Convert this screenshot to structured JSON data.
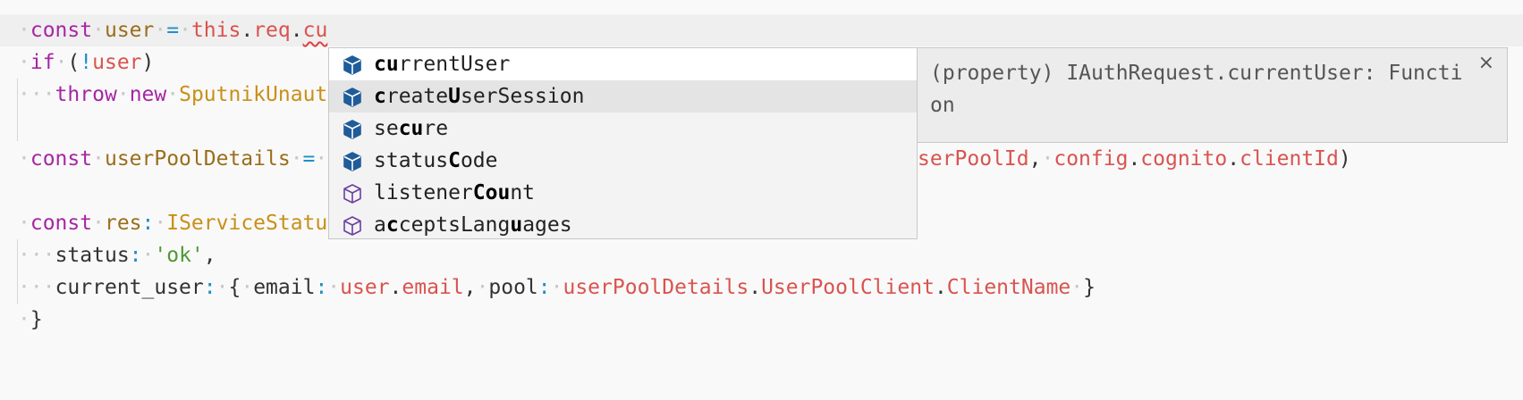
{
  "editor": {
    "line1": {
      "kw": "const",
      "var": "user",
      "op": "=",
      "this": "this",
      "req": "req",
      "partial": "cu"
    },
    "line2": {
      "kw": "if",
      "paren_open": "(",
      "bang": "!",
      "var": "user",
      "paren_close": ")"
    },
    "line3": {
      "kw1": "throw",
      "kw2": "new",
      "cls": "SputnikUnaut"
    },
    "line5": {
      "kw": "const",
      "var": "userPoolDetails",
      "op": "=",
      "tail_prop1": "serPoolId",
      "comma": ",",
      "config": "config",
      "cognito": "cognito",
      "clientId": "clientId",
      "close": ")"
    },
    "line7": {
      "kw": "const",
      "var": "res",
      "colon": ":",
      "type": "IServiceStatu"
    },
    "line8": {
      "key": "status",
      "colon": ":",
      "value": "'ok'",
      "comma": ","
    },
    "line9": {
      "key": "current_user",
      "colon": ":",
      "open": "{",
      "email_key": "email",
      "user": "user",
      "email": "email",
      "comma": ",",
      "pool_key": "pool",
      "upd": "userPoolDetails",
      "upc": "UserPoolClient",
      "cn": "ClientName",
      "close": "}"
    },
    "line10": {
      "close": "}"
    }
  },
  "suggest": {
    "items": [
      {
        "pre": "",
        "m1": "cu",
        "mid": "rrentUser",
        "m2": "",
        "post": "",
        "icon": "method-cube-icon"
      },
      {
        "pre": "",
        "m1": "c",
        "mid": "reate",
        "m2": "U",
        "post": "serSession",
        "icon": "method-cube-icon"
      },
      {
        "pre": "se",
        "m1": "cu",
        "mid": "re",
        "m2": "",
        "post": "",
        "icon": "method-cube-icon"
      },
      {
        "pre": "status",
        "m1": "C",
        "mid": "ode",
        "m2": "",
        "post": "",
        "icon": "method-cube-icon"
      },
      {
        "pre": "listener",
        "m1": "Cou",
        "mid": "nt",
        "m2": "",
        "post": "",
        "icon": "property-cube-icon"
      },
      {
        "pre": "a",
        "m1": "c",
        "mid": "ceptsLang",
        "m2": "u",
        "post": "ages",
        "icon": "property-cube-icon"
      }
    ]
  },
  "details": {
    "text": "(property) IAuthRequest.currentUser: Function",
    "close": "×"
  },
  "colors": {
    "method_icon": "#1f5c99",
    "property_icon": "#6b3fa0"
  }
}
